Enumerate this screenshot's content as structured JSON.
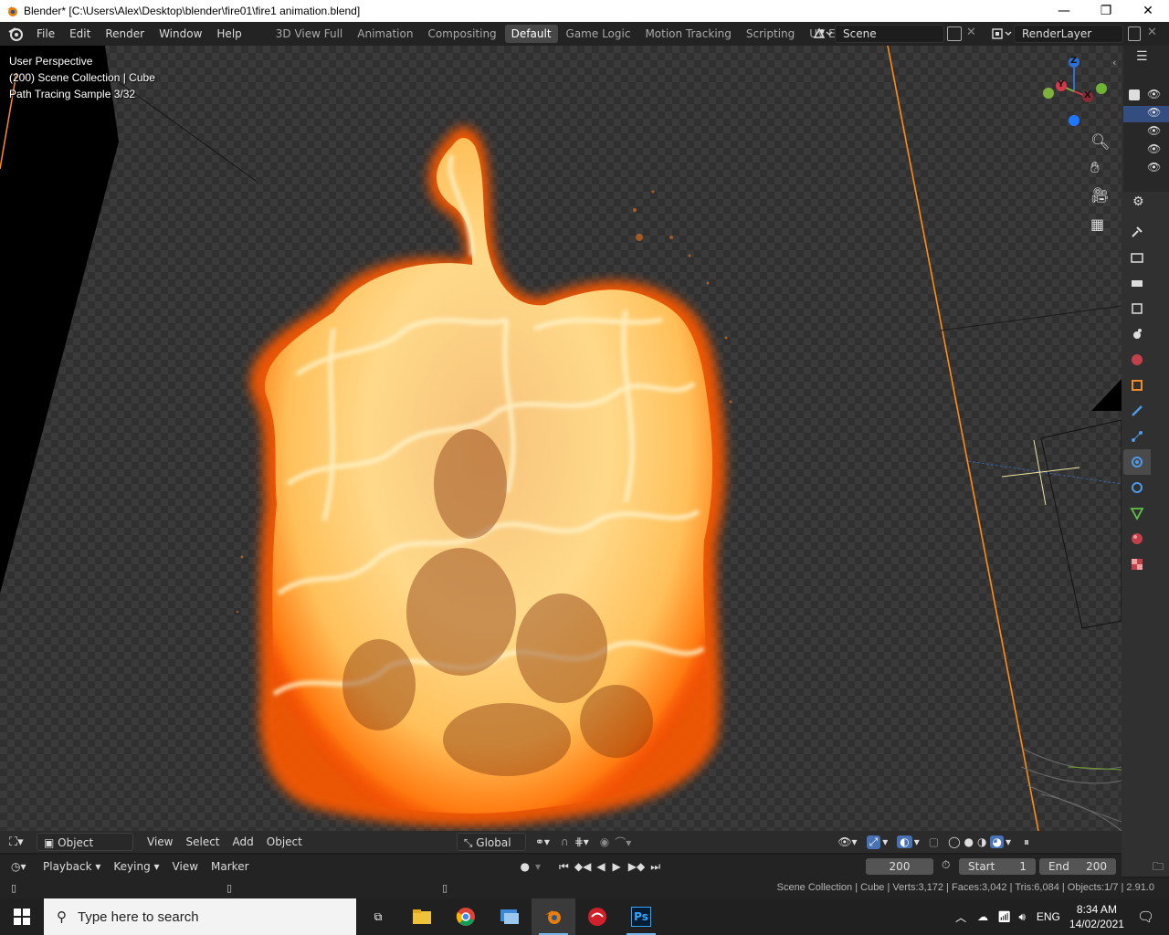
{
  "window": {
    "title": "Blender* [C:\\Users\\Alex\\Desktop\\blender\\fire01\\fire1 animation.blend]",
    "minimize_glyph": "—",
    "restore_glyph": "❐",
    "close_glyph": "✕"
  },
  "menu": [
    "File",
    "Edit",
    "Render",
    "Window",
    "Help"
  ],
  "workspaces": [
    {
      "label": "3D View Full",
      "active": false
    },
    {
      "label": "Animation",
      "active": false
    },
    {
      "label": "Compositing",
      "active": false
    },
    {
      "label": "Default",
      "active": true
    },
    {
      "label": "Game Logic",
      "active": false
    },
    {
      "label": "Motion Tracking",
      "active": false
    },
    {
      "label": "Scripting",
      "active": false
    },
    {
      "label": "UV Editing",
      "active": false
    },
    {
      "label": "V",
      "active": false
    }
  ],
  "scene": {
    "name": "Scene",
    "view_layer": "RenderLayer"
  },
  "viewport": {
    "info_line1": "User Perspective",
    "info_line2": "(200) Scene Collection | Cube",
    "info_line3": "Path Tracing Sample 3/32",
    "gizmo": {
      "z": "Z",
      "y": "Y",
      "x": "X"
    }
  },
  "viewport_header": {
    "mode": "Object Mode",
    "view": "View",
    "select": "Select",
    "add": "Add",
    "object": "Object",
    "orientation": "Global"
  },
  "timeline": {
    "playback": "Playback",
    "keying": "Keying",
    "view": "View",
    "marker": "Marker",
    "current_frame": "200",
    "start_label": "Start",
    "start_value": "1",
    "end_label": "End",
    "end_value": "200"
  },
  "status": {
    "text": "Scene Collection | Cube | Verts:3,172 | Faces:3,042 | Tris:6,084 | Objects:1/7 | 2.91.0"
  },
  "taskbar": {
    "search_placeholder": "Type here to search",
    "language": "ENG",
    "time": "8:34 AM",
    "date": "14/02/2021",
    "ps_label": "Ps"
  },
  "colors": {
    "accent": "#4772b3",
    "fire_core": "#ffe9a8",
    "fire_edge": "#ff6a00",
    "camera_line": "#ff8c1a"
  }
}
